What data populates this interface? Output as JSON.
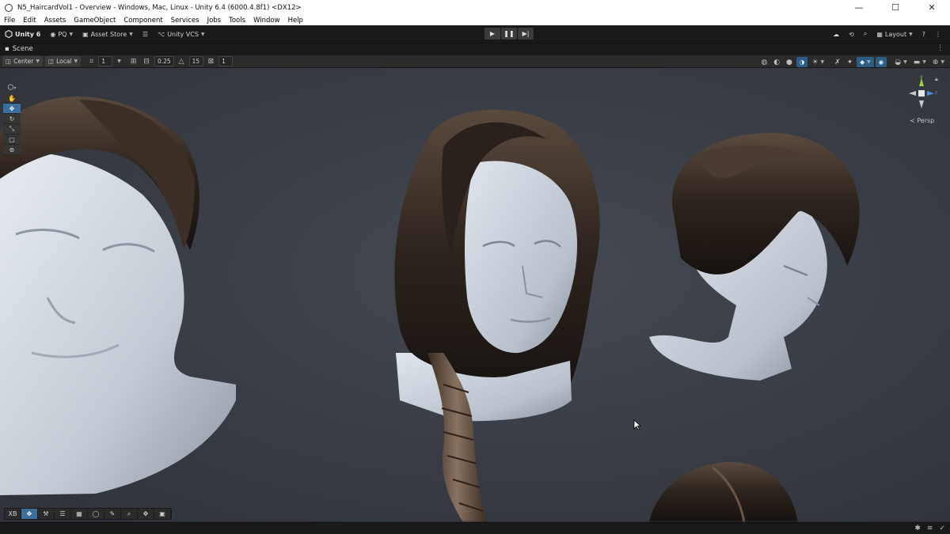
{
  "window": {
    "title": "N5_HaircardVol1 - Overview - Windows, Mac, Linux - Unity 6.4 (6000.4.8f1) <DX12>",
    "controls": {
      "minimize": "—",
      "maximize": "☐",
      "close": "✕"
    }
  },
  "menu": [
    "File",
    "Edit",
    "Assets",
    "GameObject",
    "Component",
    "Services",
    "Jobs",
    "Tools",
    "Window",
    "Help"
  ],
  "main_toolbar": {
    "unity_label": "Unity 6",
    "account_label": "PQ",
    "asset_store_label": "Asset Store",
    "vcs_label": "Unity VCS",
    "layout_label": "Layout",
    "icons": [
      "cloud-icon",
      "history-icon",
      "search-icon",
      "help-icon",
      "more-icon"
    ]
  },
  "play_controls": {
    "play": "▶",
    "pause": "❚❚",
    "step": "▶|"
  },
  "scene_tab": {
    "label": "Scene"
  },
  "scene_toolbar": {
    "pivot_label": "Center",
    "space_label": "Local",
    "grid_value": "1",
    "snap_value": "0.25",
    "rotate_snap_value": "15",
    "scale_snap_value": "1"
  },
  "tool_palette": [
    "view-tool",
    "move-tool",
    "rotate-tool",
    "scale-tool",
    "rect-tool",
    "transform-tool"
  ],
  "bottom_bar": {
    "xr_label": "XB"
  },
  "gizmo": {
    "y_label": "y",
    "z_label": "z",
    "projection_label": "Persp"
  },
  "colors": {
    "editor_bg": "#191919",
    "viewport_bg": "#3c4048",
    "active_tool": "#3d6f9c",
    "hair_dark": "#2a211c",
    "skin": "#c6ccd4"
  }
}
